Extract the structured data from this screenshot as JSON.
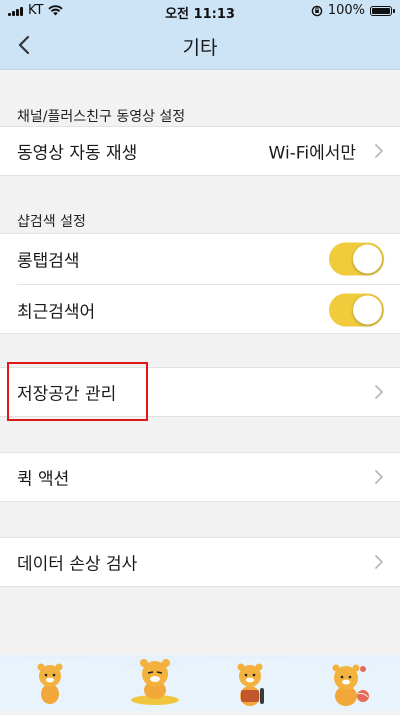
{
  "status_bar": {
    "carrier": "KT",
    "time": "오전 11:13",
    "battery": "100%"
  },
  "nav": {
    "title": "기타",
    "back_icon": "chevron-left-icon"
  },
  "sections": {
    "channel": {
      "header": "채널/플러스친구 동영상 설정",
      "auto_play_label": "동영상 자동 재생",
      "auto_play_value": "Wi-Fi에서만"
    },
    "search": {
      "header": "샵검색 설정",
      "long_tap_label": "롱탭검색",
      "long_tap_on": true,
      "recent_label": "최근검색어",
      "recent_on": true
    },
    "storage": {
      "label": "저장공간 관리"
    },
    "quick": {
      "label": "퀵 액션"
    },
    "data": {
      "label": "데이터 손상 검사"
    }
  },
  "colors": {
    "header_bg": "#cde3f6",
    "toggle_on": "#f0cc3d",
    "highlight": "#e01818",
    "page_bg": "#f2f2f2"
  }
}
